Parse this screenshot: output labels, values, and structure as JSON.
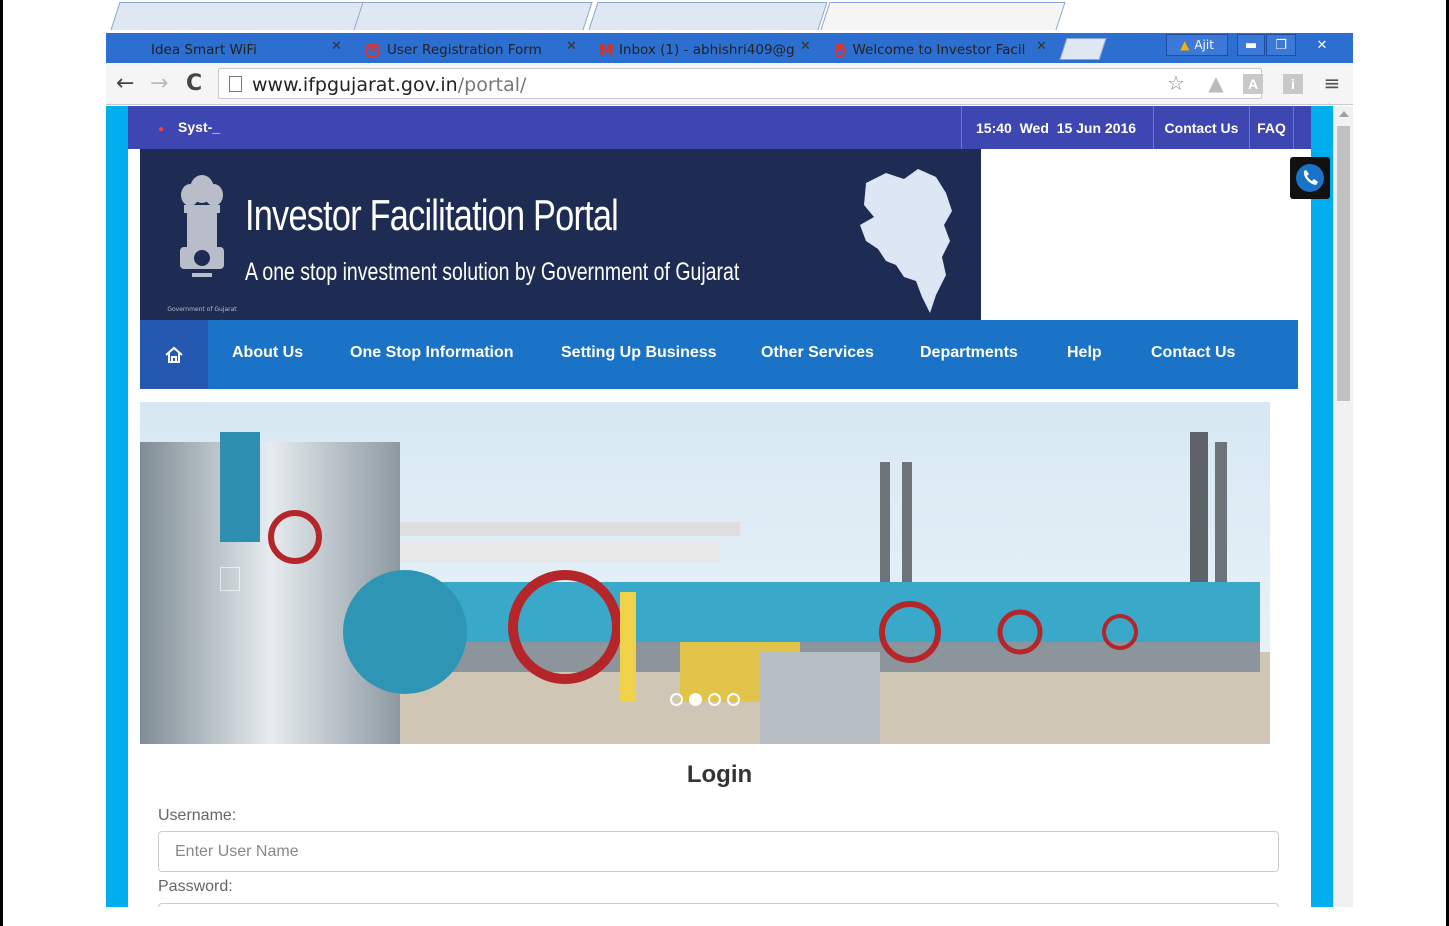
{
  "browser": {
    "tabs": [
      {
        "title": "Idea Smart WiFi",
        "icon": "blank"
      },
      {
        "title": "User Registration Form",
        "icon": "s-icon"
      },
      {
        "title": "Inbox (1) - abhishri409@g",
        "icon": "gmail-icon"
      },
      {
        "title": "Welcome to Investor Facil",
        "icon": "s-icon",
        "active": true
      }
    ],
    "close_glyph": "✕",
    "user_name": "Ajit",
    "url_host": "www.ifpgujarat.gov.in",
    "url_path": "/portal/",
    "icons": [
      "back-icon",
      "forward-icon",
      "reload-icon",
      "star-icon",
      "drive-icon",
      "a-icon",
      "info-icon",
      "menu-icon"
    ]
  },
  "topbar": {
    "ticker": "Syst‐_",
    "time": "15:40",
    "day": "Wed",
    "date": "15 Jun 2016",
    "contact": "Contact Us",
    "faq": "FAQ"
  },
  "header": {
    "title": "Investor Facilitation Portal",
    "subtitle": "A one stop investment solution by Government of Gujarat",
    "emblem_caption": "Government of Gujarat"
  },
  "nav": {
    "items": [
      "About Us",
      "One Stop Information",
      "Setting Up Business",
      "Other Services",
      "Departments",
      "Help",
      "Contact Us"
    ]
  },
  "slider": {
    "slide_count": 4,
    "active_slide": 2
  },
  "login": {
    "title": "Login",
    "username_label": "Username:",
    "username_placeholder": "Enter User Name",
    "password_label": "Password:"
  },
  "colors": {
    "accent_bar": "#3e46b1",
    "nav": "#1a73c6",
    "banner": "#1e2b52",
    "page_bg": "#00adef"
  }
}
